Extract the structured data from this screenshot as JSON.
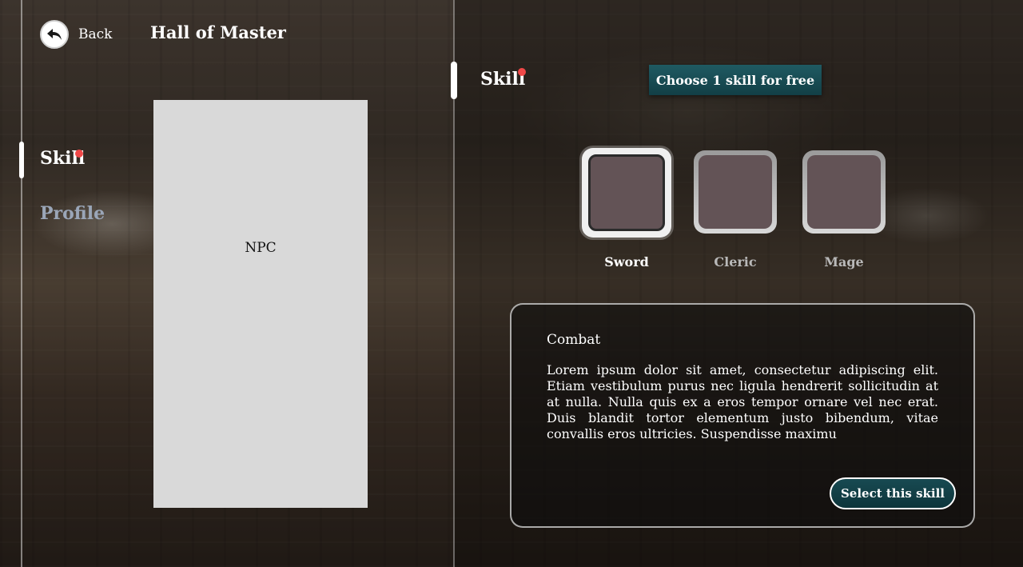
{
  "header": {
    "back_label": "Back",
    "title": "Hall of Master",
    "back_icon": "back-arrow-icon"
  },
  "sidebar": {
    "items": [
      {
        "label": "Skill",
        "active": true,
        "has_notification": true
      },
      {
        "label": "Profile",
        "active": false,
        "has_notification": false
      }
    ]
  },
  "npc": {
    "label": "NPC"
  },
  "skill_panel": {
    "title": "Skill",
    "has_notification": true,
    "free_banner": "Choose 1 skill for free",
    "skills": [
      {
        "label": "Sword",
        "selected": true
      },
      {
        "label": "Cleric",
        "selected": false
      },
      {
        "label": "Mage",
        "selected": false
      }
    ],
    "description": {
      "title": "Combat",
      "body": "Lorem ipsum dolor sit amet, consectetur adipiscing elit. Etiam vestibulum purus nec ligula hendrerit sollicitudin at at nulla. Nulla quis ex a eros tempor ornare vel nec erat. Duis blandit tortor elementum justo bibendum, vitae convallis eros ultricies. Suspendisse maximu"
    },
    "select_button": "Select this skill"
  },
  "colors": {
    "notification_dot": "#f04848",
    "accent_teal": "#1f5a62",
    "skill_tile": "#635356",
    "inactive_nav": "#9aa6b8"
  }
}
